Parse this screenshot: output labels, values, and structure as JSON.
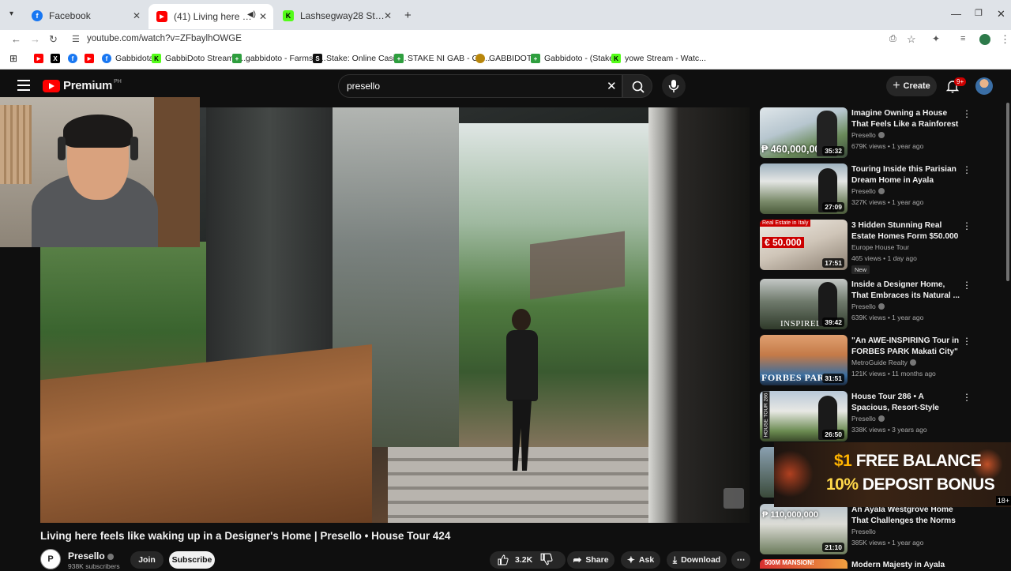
{
  "browser": {
    "tabs": [
      {
        "title": "Facebook",
        "favicon_color": "#1877f2",
        "favicon_glyph": "f"
      },
      {
        "title": "(41) Living here feels like waking up",
        "favicon_color": "#ff0000",
        "favicon_glyph": "▶"
      },
      {
        "title": "Lashsegway28 Stream - Watch",
        "favicon_color": "#53fc18",
        "favicon_glyph": "K"
      }
    ],
    "new_tab": "+",
    "url": "youtube.com/watch?v=ZFbaylhOWGE",
    "bookmarks": [
      {
        "label": "",
        "color": "#ff0000",
        "glyph": "▶"
      },
      {
        "label": "",
        "color": "#000000",
        "glyph": "X"
      },
      {
        "label": "",
        "color": "#1877f2",
        "glyph": "f"
      },
      {
        "label": "",
        "color": "#ff0000",
        "glyph": "▶"
      },
      {
        "label": "Gabbidota",
        "color": "#1877f2",
        "glyph": "f"
      },
      {
        "label": "GabbiDoto Stream -...",
        "color": "#53fc18",
        "glyph": "K"
      },
      {
        "label": "gabbidoto - Farmski...",
        "color": "#2e9e3e",
        "glyph": "+"
      },
      {
        "label": "Stake: Online Casin...",
        "color": "#111111",
        "glyph": "S"
      },
      {
        "label": "STAKE NI GAB - Go...",
        "color": "#2e9e3e",
        "glyph": "+"
      },
      {
        "label": "GABBIDOTO",
        "color": "#b8860b",
        "glyph": "●"
      },
      {
        "label": "Gabbidoto - (Stake...",
        "color": "#2e9e3e",
        "glyph": "+"
      },
      {
        "label": "yowe Stream - Watc...",
        "color": "#53fc18",
        "glyph": "K"
      }
    ]
  },
  "youtube": {
    "logo_text": "Premium",
    "region": "PH",
    "search_value": "presello",
    "create_label": "Create",
    "notif_count": "9+"
  },
  "video": {
    "title": "Living here feels like waking up in a Designer's Home | Presello • House Tour 424",
    "channel": "Presello",
    "subscribers": "938K subscribers",
    "join_label": "Join",
    "subscribe_label": "Subscribe",
    "likes": "3.2K",
    "share_label": "Share",
    "ask_label": "Ask",
    "download_label": "Download"
  },
  "related": [
    {
      "title": "Imagine Owning a House That Feels Like a Rainforest | ...",
      "channel": "Presello",
      "verified": true,
      "meta": "679K views • 1 year ago",
      "duration": "35:32",
      "thumb_text": "₱ 460,000,000"
    },
    {
      "title": "Touring Inside this Parisian Dream Home in Ayala Alabang...",
      "channel": "Presello",
      "verified": true,
      "meta": "327K views • 1 year ago",
      "duration": "27:09",
      "thumb_text": ""
    },
    {
      "title": "3 Hidden Stunning Real Estate Homes Form $50.000 | ...",
      "channel": "Europe House Tour",
      "verified": false,
      "meta": "465 views • 1 day ago",
      "duration": "17:51",
      "thumb_text": "€ 50.000",
      "badge": "New"
    },
    {
      "title": "Inside a Designer Home, That Embraces its Natural ...",
      "channel": "Presello",
      "verified": true,
      "meta": "639K views • 1 year ago",
      "duration": "39:42",
      "thumb_text": "INSPIRED"
    },
    {
      "title": "\"An AWE-INSPIRING Tour in FORBES PARK Makati City\" • ...",
      "channel": "MetroGuide Realty",
      "verified": true,
      "meta": "121K views • 11 months ago",
      "duration": "31:51",
      "thumb_text": "FORBES PARK"
    },
    {
      "title": "House Tour 286 • A Spacious, Resort-Style Family Home in ...",
      "channel": "Presello",
      "verified": true,
      "meta": "338K views • 3 years ago",
      "duration": "26:50",
      "thumb_text": "HOUSE TOUR 286"
    },
    {
      "title": "An Ayala Westgrove Home That Challenges the Norms • Presel...",
      "channel": "Presello",
      "verified": false,
      "meta": "385K views • 1 year ago",
      "duration": "21:10",
      "thumb_text": "₱ 110,000,000"
    },
    {
      "title": "Modern Majesty in Ayala",
      "channel": "",
      "verified": false,
      "meta": "",
      "duration": "",
      "thumb_text": "500M MANSION!"
    }
  ],
  "ad": {
    "line1_dollar": "$1",
    "line1_rest": " FREE BALANCE",
    "line2_pct": "10%",
    "line2_rest": " DEPOSIT BONUS",
    "age": "18+"
  }
}
